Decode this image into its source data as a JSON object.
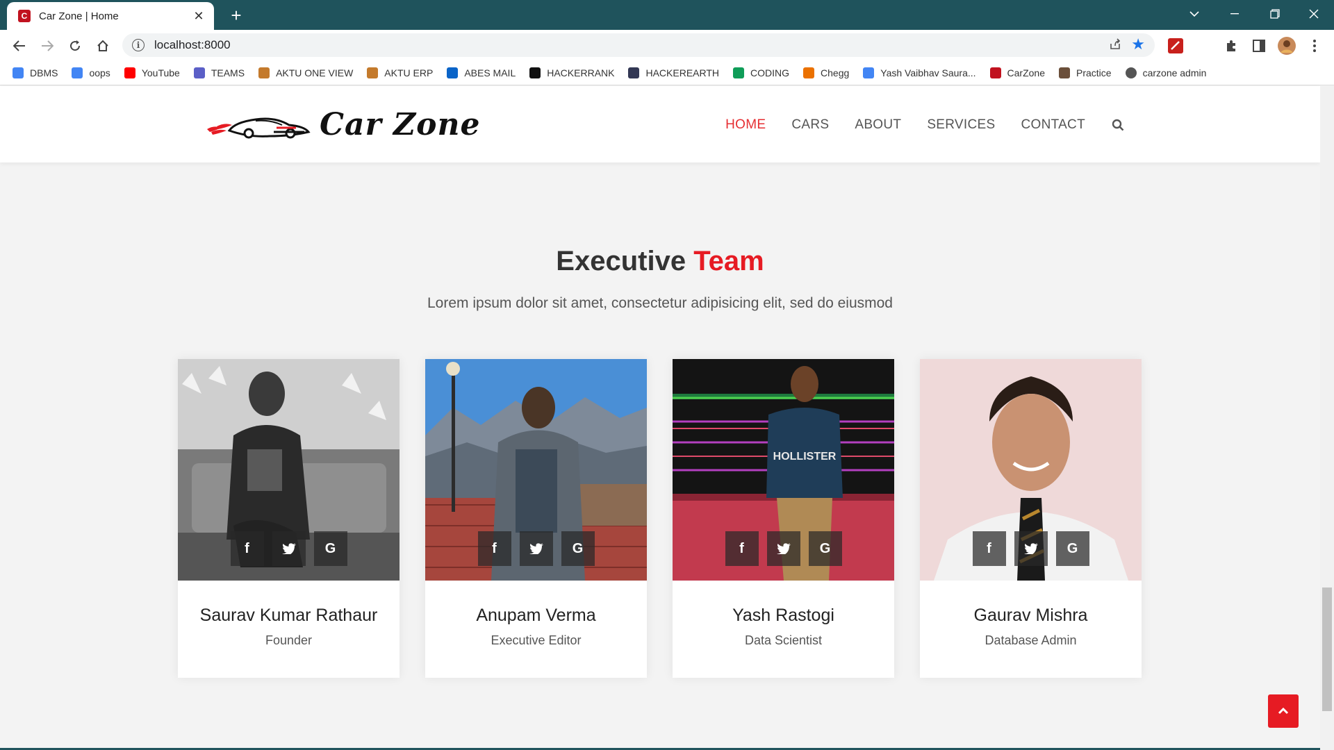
{
  "browser": {
    "tab_title": "Car Zone | Home",
    "favicon_letter": "C",
    "url": "localhost:8000",
    "bookmarks": [
      {
        "label": "DBMS",
        "icon": "docs-icon",
        "color": "#4285f4"
      },
      {
        "label": "oops",
        "icon": "docs-icon",
        "color": "#4285f4"
      },
      {
        "label": "YouTube",
        "icon": "youtube-icon",
        "color": "#ff0000"
      },
      {
        "label": "TEAMS",
        "icon": "teams-icon",
        "color": "#5b5fc7"
      },
      {
        "label": "AKTU ONE VIEW",
        "icon": "aktu-icon",
        "color": "#c47a2c"
      },
      {
        "label": "AKTU ERP",
        "icon": "aktu-icon",
        "color": "#c47a2c"
      },
      {
        "label": "ABES MAIL",
        "icon": "outlook-icon",
        "color": "#0a64c8"
      },
      {
        "label": "HACKERRANK",
        "icon": "hackerrank-icon",
        "color": "#111111"
      },
      {
        "label": "HACKEREARTH",
        "icon": "hackerearth-icon",
        "color": "#323754"
      },
      {
        "label": "CODING",
        "icon": "sheets-icon",
        "color": "#0f9d58"
      },
      {
        "label": "Chegg",
        "icon": "chegg-icon",
        "color": "#eb7100"
      },
      {
        "label": "Yash Vaibhav Saura...",
        "icon": "docs-icon",
        "color": "#4285f4"
      },
      {
        "label": "CarZone",
        "icon": "carzone-icon",
        "color": "#c1121f"
      },
      {
        "label": "Practice",
        "icon": "practice-icon",
        "color": "#6b4f3a"
      },
      {
        "label": "carzone admin",
        "icon": "globe-icon",
        "color": "#555555"
      }
    ]
  },
  "header": {
    "logo_text": "Car Zone",
    "nav": [
      "HOME",
      "CARS",
      "ABOUT",
      "SERVICES",
      "CONTACT"
    ]
  },
  "section": {
    "title_main": "Executive",
    "title_accent": "Team",
    "subtitle": "Lorem ipsum dolor sit amet, consectetur adipisicing elit, sed do eiusmod"
  },
  "team": [
    {
      "name": "Saurav Kumar Rathaur",
      "role": "Founder"
    },
    {
      "name": "Anupam Verma",
      "role": "Executive Editor"
    },
    {
      "name": "Yash Rastogi",
      "role": "Data Scientist"
    },
    {
      "name": "Gaurav Mishra",
      "role": "Database Admin"
    }
  ],
  "social_labels": {
    "facebook": "f",
    "twitter": "t",
    "google": "G"
  },
  "colors": {
    "accent": "#e61b23",
    "chrome": "#1f535c"
  }
}
